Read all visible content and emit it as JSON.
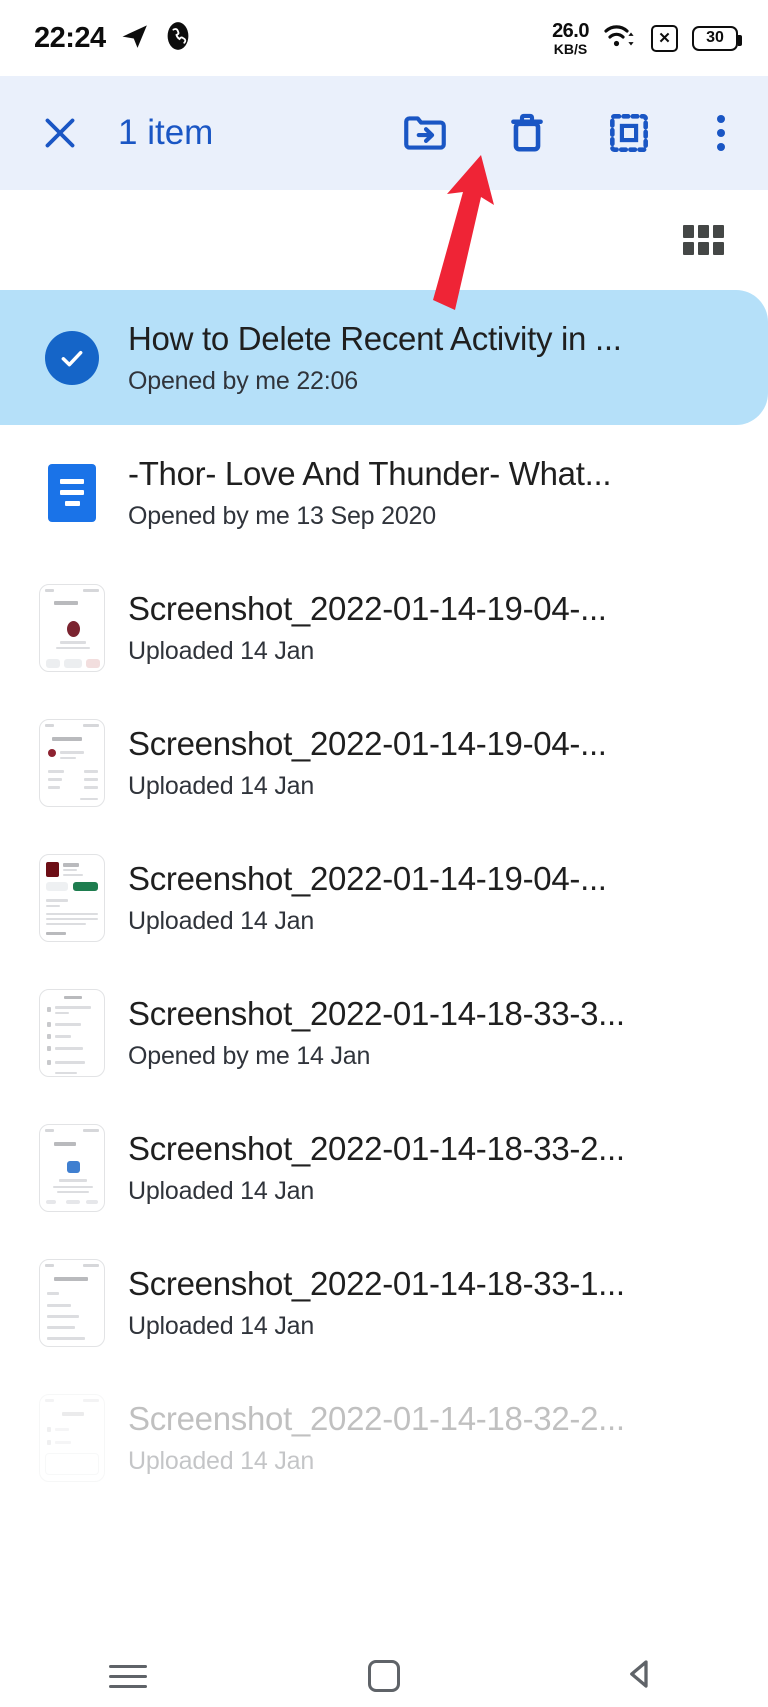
{
  "status_bar": {
    "clock": "22:24",
    "network_speed_value": "26.0",
    "network_speed_unit": "KB/S",
    "battery_level": "30",
    "icons": [
      "telegram-send-icon",
      "call-icon",
      "wifi-icon",
      "sim-x-icon",
      "battery-icon"
    ]
  },
  "toolbar": {
    "close_label": "✕",
    "selection_count": "1 item",
    "accent_color": "#1a56c4",
    "background_color": "#eaf0fb",
    "actions": [
      {
        "name": "move-to-folder-button",
        "label": "Move"
      },
      {
        "name": "delete-button",
        "label": "Delete"
      },
      {
        "name": "select-all-button",
        "label": "Select all"
      },
      {
        "name": "more-options-button",
        "label": "More options"
      }
    ]
  },
  "view_toggle": {
    "label": "Grid view",
    "icon": "grid-view-icon"
  },
  "annotation": {
    "type": "red-arrow",
    "points_at": "delete-button",
    "color": "#ef2436"
  },
  "files": [
    {
      "name": "How to Delete Recent Activity in ...",
      "subtitle": "Opened by me 22:06",
      "icon": "check-circle-icon",
      "selected": true
    },
    {
      "name": "-Thor- Love And Thunder- What...",
      "subtitle": "Opened by me 13 Sep 2020",
      "icon": "google-docs-icon",
      "selected": false
    },
    {
      "name": "Screenshot_2022-01-14-19-04-...",
      "subtitle": "Uploaded 14 Jan",
      "icon": "image-thumbnail",
      "selected": false
    },
    {
      "name": "Screenshot_2022-01-14-19-04-...",
      "subtitle": "Uploaded 14 Jan",
      "icon": "image-thumbnail",
      "selected": false
    },
    {
      "name": "Screenshot_2022-01-14-19-04-...",
      "subtitle": "Uploaded 14 Jan",
      "icon": "image-thumbnail",
      "selected": false
    },
    {
      "name": "Screenshot_2022-01-14-18-33-3...",
      "subtitle": "Opened by me 14 Jan",
      "icon": "image-thumbnail",
      "selected": false
    },
    {
      "name": "Screenshot_2022-01-14-18-33-2...",
      "subtitle": "Uploaded 14 Jan",
      "icon": "image-thumbnail",
      "selected": false
    },
    {
      "name": "Screenshot_2022-01-14-18-33-1...",
      "subtitle": "Uploaded 14 Jan",
      "icon": "image-thumbnail",
      "selected": false
    },
    {
      "name": "Screenshot_2022-01-14-18-32-2...",
      "subtitle": "Uploaded 14 Jan",
      "icon": "image-thumbnail",
      "selected": false
    }
  ],
  "nav_bar": {
    "recents_label": "Recents",
    "home_label": "Home",
    "back_label": "Back"
  }
}
